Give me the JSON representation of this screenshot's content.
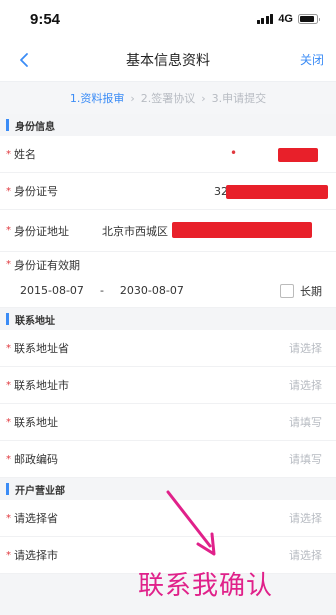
{
  "status_bar": {
    "time": "9:54",
    "network": "4G"
  },
  "nav": {
    "title": "基本信息资料",
    "close": "关闭"
  },
  "steps": [
    "1.资料报审",
    "2.签署协议",
    "3.申请提交"
  ],
  "step_separator": "›",
  "sections": {
    "identity": {
      "title": "身份信息",
      "name_label": "姓名",
      "id_label": "身份证号",
      "id_prefix": "32",
      "address_label": "身份证地址",
      "address_value": "北京市西城区",
      "validity_label": "身份证有效期",
      "start_date": "2015-08-07",
      "date_separator": "-",
      "end_date": "2030-08-07",
      "long_term_label": "长期"
    },
    "contact": {
      "title": "联系地址",
      "province_label": "联系地址省",
      "province_placeholder": "请选择",
      "city_label": "联系地址市",
      "city_placeholder": "请选择",
      "address_label": "联系地址",
      "address_placeholder": "请填写",
      "postcode_label": "邮政编码",
      "postcode_placeholder": "请填写"
    },
    "branch": {
      "title": "开户营业部",
      "province_label": "请选择省",
      "province_placeholder": "请选择",
      "city_label": "请选择市",
      "city_placeholder": "请选择"
    }
  },
  "required_mark": "*",
  "overlay_text": "联系我确认",
  "colors": {
    "accent": "#3b8cf6",
    "required": "#e0383e",
    "redaction": "#e8202a",
    "annotation": "#e0218a"
  }
}
